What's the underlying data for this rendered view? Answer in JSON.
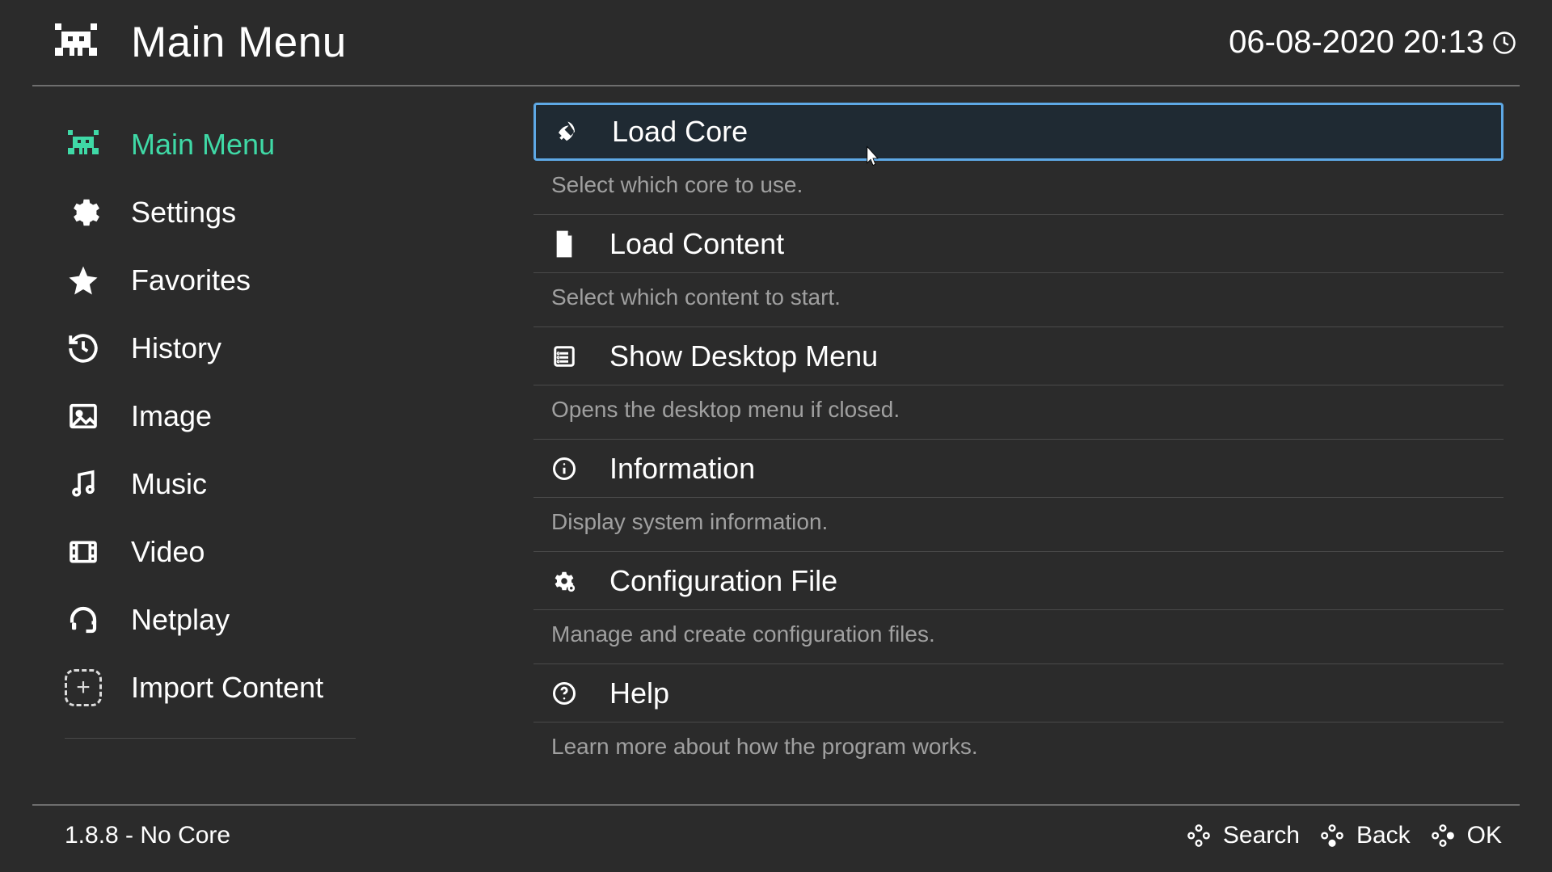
{
  "header": {
    "title": "Main Menu",
    "datetime": "06-08-2020 20:13"
  },
  "sidebar": {
    "items": [
      {
        "id": "main-menu",
        "label": "Main Menu",
        "active": true
      },
      {
        "id": "settings",
        "label": "Settings"
      },
      {
        "id": "favorites",
        "label": "Favorites"
      },
      {
        "id": "history",
        "label": "History"
      },
      {
        "id": "image",
        "label": "Image"
      },
      {
        "id": "music",
        "label": "Music"
      },
      {
        "id": "video",
        "label": "Video"
      },
      {
        "id": "netplay",
        "label": "Netplay"
      },
      {
        "id": "import-content",
        "label": "Import Content"
      }
    ]
  },
  "main": {
    "items": [
      {
        "id": "load-core",
        "label": "Load Core",
        "desc": "Select which core to use.",
        "selected": true
      },
      {
        "id": "load-content",
        "label": "Load Content",
        "desc": "Select which content to start."
      },
      {
        "id": "show-desktop-menu",
        "label": "Show Desktop Menu",
        "desc": "Opens the desktop menu if closed."
      },
      {
        "id": "information",
        "label": "Information",
        "desc": "Display system information."
      },
      {
        "id": "configuration-file",
        "label": "Configuration File",
        "desc": "Manage and create configuration files."
      },
      {
        "id": "help",
        "label": "Help",
        "desc": "Learn more about how the program works."
      }
    ]
  },
  "footer": {
    "status": "1.8.8 - No Core",
    "buttons": [
      {
        "id": "search",
        "label": "Search"
      },
      {
        "id": "back",
        "label": "Back"
      },
      {
        "id": "ok",
        "label": "OK"
      }
    ]
  }
}
